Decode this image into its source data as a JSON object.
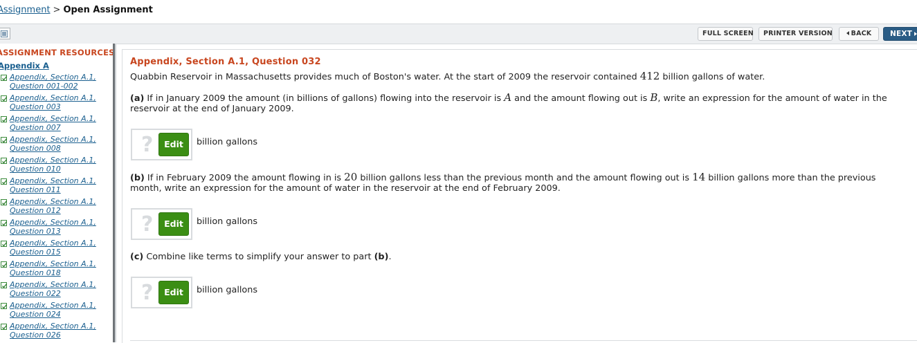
{
  "breadcrumb": {
    "parent": "Assignment",
    "separator": ">",
    "current": "Open Assignment"
  },
  "toolbar": {
    "full_screen": "FULL SCREEN",
    "printer_version": "PRINTER VERSION",
    "back": "BACK",
    "next": "NEXT"
  },
  "sidebar": {
    "heading": "ASSIGNMENT RESOURCES",
    "section": "Appendix A",
    "items": [
      {
        "label": "Appendix, Section A.1, Question 001-002"
      },
      {
        "label": "Appendix, Section A.1, Question 003"
      },
      {
        "label": "Appendix, Section A.1, Question 007"
      },
      {
        "label": "Appendix, Section A.1, Question 008"
      },
      {
        "label": "Appendix, Section A.1, Question 010"
      },
      {
        "label": "Appendix, Section A.1, Question 011"
      },
      {
        "label": "Appendix, Section A.1, Question 012"
      },
      {
        "label": "Appendix, Section A.1, Question 013"
      },
      {
        "label": "Appendix, Section A.1, Question 015"
      },
      {
        "label": "Appendix, Section A.1, Question 018"
      },
      {
        "label": "Appendix, Section A.1, Question 022"
      },
      {
        "label": "Appendix, Section A.1, Question 024"
      },
      {
        "label": "Appendix, Section A.1, Question 026"
      }
    ]
  },
  "question": {
    "title": "Appendix, Section A.1, Question 032",
    "intro_before": "Quabbin Reservoir in Massachusetts provides much of Boston's water. At the start of 2009 the reservoir contained ",
    "intro_value": "412",
    "intro_after": " billion gallons of water.",
    "part_a": {
      "tag": "(a)",
      "text1": " If in January 2009 the amount (in billions of gallons) flowing into the reservoir is ",
      "var_in": "A",
      "text2": " and the amount flowing out is ",
      "var_out": "B",
      "text3": ", write an expression for the amount of water in the reservoir at the end of January 2009."
    },
    "part_b": {
      "tag": "(b)",
      "text1": " If in February 2009 the amount flowing in is ",
      "value_in": "20",
      "text2": " billion gallons less than the previous month and the amount flowing out is ",
      "value_out": "14",
      "text3": " billion gallons more than the previous month, write an expression for the amount of water in the reservoir at the end of February 2009."
    },
    "part_c": {
      "tag": "(c)",
      "text1": " Combine like terms to simplify your answer to part ",
      "ref": "(b)",
      "text2": "."
    },
    "answer": {
      "placeholder": "?",
      "edit_label": "Edit",
      "unit": "billion gallons"
    }
  }
}
